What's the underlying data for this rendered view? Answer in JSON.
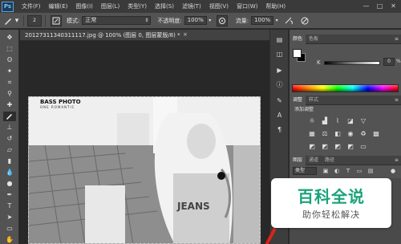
{
  "app": {
    "logo": "Ps",
    "menu": [
      "文件(F)",
      "编辑(E)",
      "图像(I)",
      "图层(L)",
      "类型(Y)",
      "选择(S)",
      "滤镜(T)",
      "视图(V)",
      "窗口(W)",
      "帮助(H)"
    ],
    "window_controls": [
      "—",
      "□",
      "✕"
    ]
  },
  "options_bar": {
    "brush_size": "2",
    "mode_label": "模式:",
    "mode_value": "正常",
    "opacity_label": "不透明度:",
    "opacity_value": "100%",
    "flow_label": "流量:",
    "flow_value": "100%"
  },
  "document": {
    "tab_title": "20127311340311117.jpg @ 100% (图层 0, 图层蒙版/8) *",
    "close": "×",
    "watermark_line1": "BASS   PHOTO",
    "watermark_line2": "ONE     ROMANTIC",
    "shirt_text": "JEANS"
  },
  "panels": {
    "color_tabs": [
      "颜色",
      "色板"
    ],
    "slider_label": "K",
    "slider_value": "0",
    "slider_unit": "%",
    "adjust_tabs": [
      "调整",
      "样式"
    ],
    "adjust_title": "添加调整",
    "layers_tabs": [
      "图层",
      "通道",
      "路径"
    ],
    "layer_kind": "类型",
    "panel_menu": "≡"
  },
  "overlay": {
    "title": "百科全说",
    "subtitle": "助你轻松解决"
  },
  "colors": {
    "accent": "#1aa37a",
    "ui_dark": "#282828",
    "ui_mid": "#535353"
  }
}
